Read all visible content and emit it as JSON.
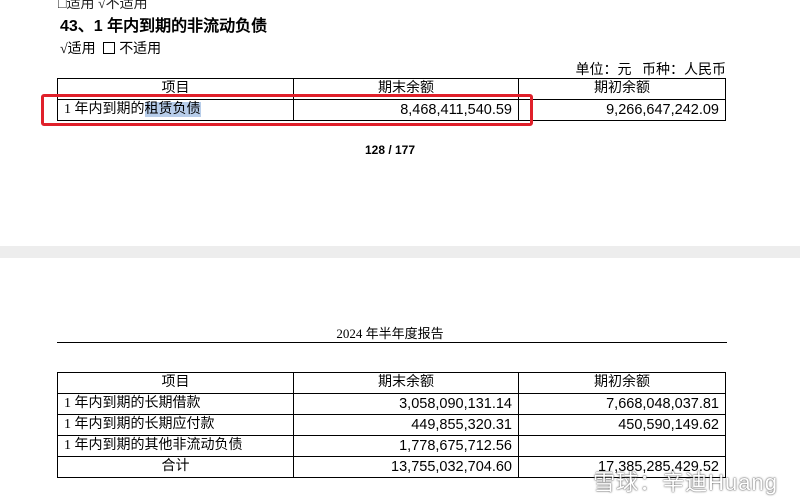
{
  "top": {
    "cut_line": "□适用 √不适用",
    "section_title": "43、1 年内到期的非流动负债",
    "applicable": "√适用",
    "not_applicable": "不适用",
    "unit": "单位：元",
    "currency": "币种：人民币",
    "table": {
      "headers": [
        "项目",
        "期末余额",
        "期初余额"
      ],
      "row": {
        "item_prefix": "1 年内到期的",
        "item_highlight": "租赁负债",
        "end": "8,468,411,540.59",
        "begin": "9,266,647,242.09"
      }
    },
    "page_number": "128 / 177"
  },
  "bottom": {
    "report_header": "2024 年半年度报告",
    "table": {
      "headers": [
        "项目",
        "期末余额",
        "期初余额"
      ],
      "rows": [
        {
          "item": "1 年内到期的长期借款",
          "end": "3,058,090,131.14",
          "begin": "7,668,048,037.81"
        },
        {
          "item": "1 年内到期的长期应付款",
          "end": "449,855,320.31",
          "begin": "450,590,149.62"
        },
        {
          "item": "1 年内到期的其他非流动负债",
          "end": "1,778,675,712.56",
          "begin": ""
        },
        {
          "item": "合计",
          "end": "13,755,032,704.60",
          "begin": "17,385,285,429.52"
        }
      ]
    },
    "watermark": "雪球：辛迪Huang"
  }
}
